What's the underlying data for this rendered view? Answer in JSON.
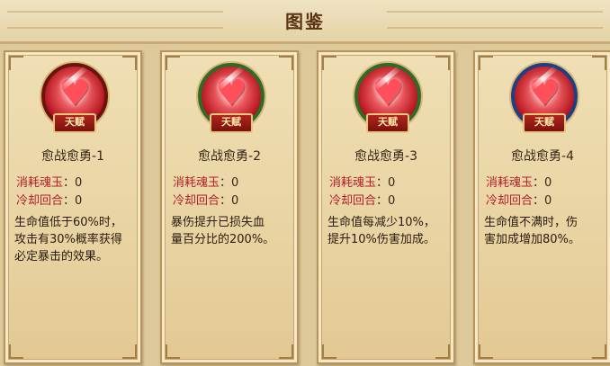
{
  "title": "图鉴",
  "cards": [
    {
      "name": "愈战愈勇-1",
      "badge": "天赋",
      "ring_color": "#6a1410",
      "cost_label": "消耗魂玉",
      "cost_value": "：0",
      "cooldown_label": "冷却回合",
      "cooldown_value": "：0",
      "description": "生命值低于60%时，\n攻击有30%概率获得\n必定暴击的效果。"
    },
    {
      "name": "愈战愈勇-2",
      "badge": "天赋",
      "ring_color": "#2e6a2a",
      "cost_label": "消耗魂玉",
      "cost_value": "：0",
      "cooldown_label": "冷却回合",
      "cooldown_value": "：0",
      "description": "暴伤提升已损失血\n量百分比的200%。"
    },
    {
      "name": "愈战愈勇-3",
      "badge": "天赋",
      "ring_color": "#2e6a2a",
      "cost_label": "消耗魂玉",
      "cost_value": "：0",
      "cooldown_label": "冷却回合",
      "cooldown_value": "：0",
      "description": "生命值每减少10%，\n提升10%伤害加成。"
    },
    {
      "name": "愈战愈勇-4",
      "badge": "天赋",
      "ring_color": "#1d3f86",
      "cost_label": "消耗魂玉",
      "cost_value": "：0",
      "cooldown_label": "冷却回合",
      "cooldown_value": "：0",
      "description": "生命值不满时，伤\n害加成增加80%。"
    }
  ]
}
